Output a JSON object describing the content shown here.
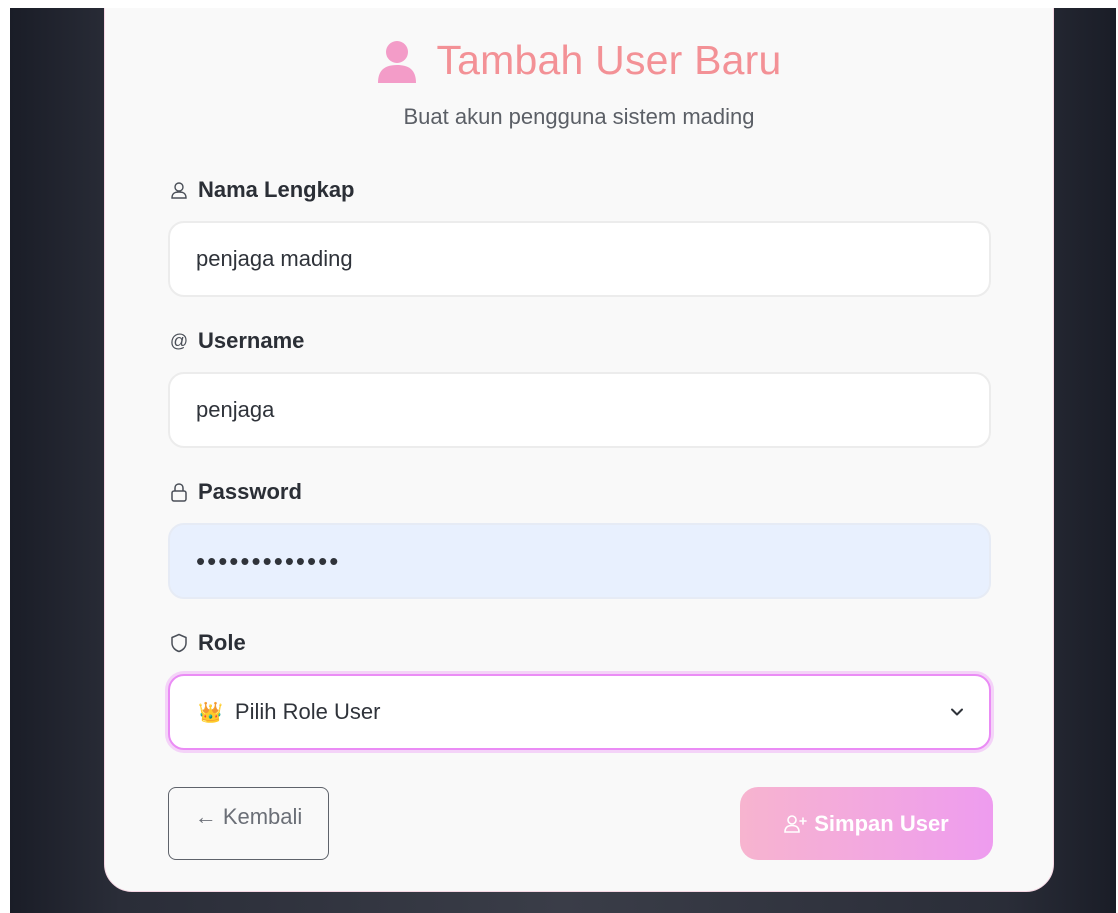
{
  "header": {
    "title": "Tambah User Baru",
    "subtitle": "Buat akun pengguna sistem mading",
    "icon": "user-icon"
  },
  "form": {
    "nama": {
      "label": "Nama Lengkap",
      "icon": "user-outline-icon",
      "value": "penjaga mading"
    },
    "username": {
      "label": "Username",
      "icon": "at-icon",
      "icon_glyph": "@",
      "value": "penjaga"
    },
    "password": {
      "label": "Password",
      "icon": "lock-icon",
      "value": "•••••••••••••"
    },
    "role": {
      "label": "Role",
      "icon": "shield-icon",
      "selected": "Pilih Role User",
      "selected_emoji": "👑"
    }
  },
  "actions": {
    "back_label": "← Kembali",
    "save_label": "Simpan User"
  },
  "colors": {
    "title": "#f39196",
    "select_focus": "#ea8cf5",
    "save_gradient_start": "#f7b4cf",
    "save_gradient_end": "#ee9cef",
    "autofill_bg": "#e8f0fe"
  }
}
